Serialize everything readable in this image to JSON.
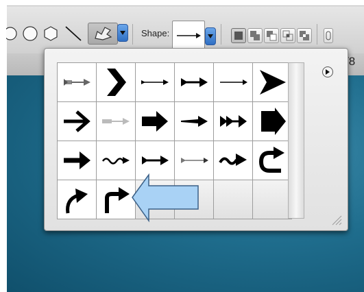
{
  "toolbar": {
    "shape_label": "Shape:",
    "tools": [
      "ellipse-tool",
      "polygon-tool",
      "line-tool",
      "custom-shape-tool"
    ],
    "selected_tool": "custom-shape-tool",
    "modes": [
      "new-layer",
      "add",
      "subtract",
      "intersect",
      "exclude"
    ]
  },
  "strip": {
    "partial_text": "/8"
  },
  "picker": {
    "shapes": [
      "arrow-feathered-1",
      "chevron-bold",
      "arrow-thin-1",
      "arrow-double-head",
      "arrow-simple",
      "arrowhead-large",
      "arrow-bold",
      "arrow-feathered-2",
      "arrow-block",
      "arrow-tapered",
      "arrow-triple-head",
      "arrow-pentagon",
      "arrow-heavy",
      "arrow-wavy",
      "arrow-crossed",
      "arrow-feathered-3",
      "arrow-squiggle",
      "arrow-u-turn",
      "arrow-curved-right",
      "arrow-turn-right"
    ],
    "menu_icon": "triangle-right-icon"
  },
  "colors": {
    "accent": "#3f7fd6",
    "callout": "#a9d2f5",
    "workspace": "#1f6d8d"
  }
}
